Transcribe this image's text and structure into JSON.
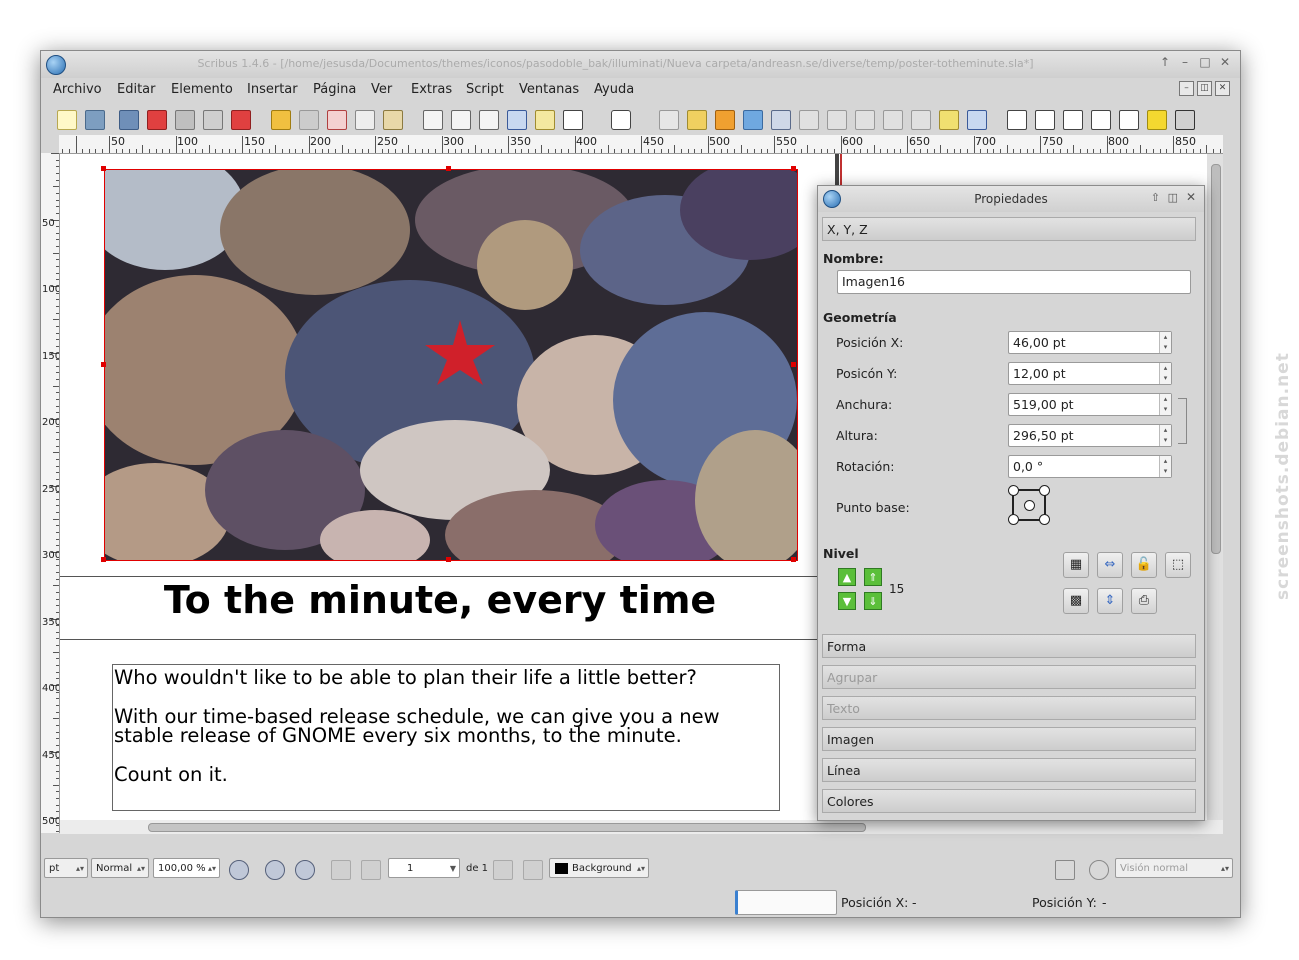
{
  "window": {
    "title": "Scribus 1.4.6 - [/home/jesusda/Documentos/themes/iconos/pasodoble_bak/illuminati/Nueva carpeta/andreasn.se/diverse/temp/poster-totheminute.sla*]",
    "controls": [
      "↑",
      "–",
      "□",
      "✕"
    ]
  },
  "menu": [
    "Archivo",
    "Editar",
    "Elemento",
    "Insertar",
    "Página",
    "Ver",
    "Extras",
    "Script",
    "Ventanas",
    "Ayuda"
  ],
  "ruler": {
    "h_labels": [
      "50",
      "100",
      "150",
      "200",
      "250",
      "300",
      "350",
      "400",
      "450",
      "500",
      "550",
      "600",
      "650",
      "700",
      "750",
      "800",
      "850"
    ],
    "v_labels": [
      "50",
      "100",
      "150",
      "200",
      "250",
      "300",
      "350",
      "400",
      "450",
      "500"
    ]
  },
  "document": {
    "headline": "To the minute, every time",
    "paragraphs": [
      "Who wouldn't like to be able to plan their life a little better?",
      "With our time-based release schedule, we can give you a new",
      "stable release of GNOME every six months, to the minute.",
      "Count on it."
    ]
  },
  "properties": {
    "title": "Propiedades",
    "tab_xyz": "X, Y, Z",
    "name_label": "Nombre:",
    "name_value": "Imagen16",
    "geometry_label": "Geometría",
    "fields": [
      {
        "label": "Posición X:",
        "value": "46,00 pt"
      },
      {
        "label": "Posicón Y:",
        "value": "12,00 pt"
      },
      {
        "label": "Anchura:",
        "value": "519,00 pt"
      },
      {
        "label": "Altura:",
        "value": "296,50 pt"
      },
      {
        "label": "Rotación:",
        "value": "0,0 °"
      }
    ],
    "base_point_label": "Punto base:",
    "level_label": "Nivel",
    "level_value": "15",
    "sections": [
      {
        "label": "Forma",
        "enabled": true
      },
      {
        "label": "Agrupar",
        "enabled": false
      },
      {
        "label": "Texto",
        "enabled": false
      },
      {
        "label": "Imagen",
        "enabled": true
      },
      {
        "label": "Línea",
        "enabled": true
      },
      {
        "label": "Colores",
        "enabled": true
      }
    ]
  },
  "bottombar": {
    "unit": "pt",
    "quality": "Normal",
    "zoom": "100,00 %",
    "page_current": "1",
    "page_of": "de 1",
    "layer": "Background",
    "view_mode": "Visión normal"
  },
  "status": {
    "pos_x_label": "Posición X:",
    "pos_x_value": "-",
    "pos_y_label": "Posición Y:",
    "pos_y_value": "-"
  },
  "watermark": "screenshots.debian.net",
  "colors": {
    "selection": "#e00000",
    "level_arrows": "#5bbf3a",
    "starfish": "#d0202a"
  }
}
